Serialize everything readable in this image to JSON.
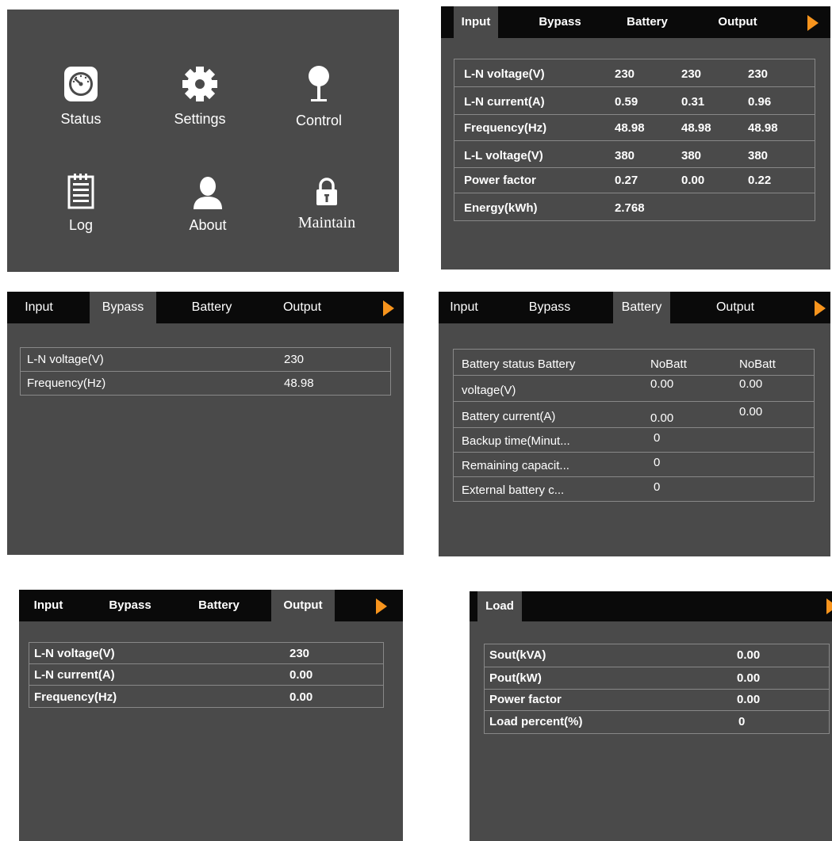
{
  "home": {
    "items": [
      {
        "label": "Status",
        "icon": "gauge-icon"
      },
      {
        "label": "Settings",
        "icon": "gear-icon"
      },
      {
        "label": "Control",
        "icon": "pin-icon"
      },
      {
        "label": "Log",
        "icon": "notepad-icon"
      },
      {
        "label": "About",
        "icon": "person-icon"
      },
      {
        "label": "Maintain",
        "icon": "lock-icon"
      }
    ]
  },
  "tabs": [
    "Input",
    "Bypass",
    "Battery",
    "Output"
  ],
  "input_panel": {
    "rows": [
      {
        "label": "L-N voltage(V)",
        "v1": "230",
        "v2": "230",
        "v3": "230"
      },
      {
        "label": "L-N current(A)",
        "v1": "0.59",
        "v2": "0.31",
        "v3": "0.96"
      },
      {
        "label": "Frequency(Hz)",
        "v1": "48.98",
        "v2": "48.98",
        "v3": "48.98"
      },
      {
        "label": "L-L voltage(V)",
        "v1": "380",
        "v2": "380",
        "v3": "380"
      },
      {
        "label": "Power factor",
        "v1": "0.27",
        "v2": "0.00",
        "v3": "0.22"
      },
      {
        "label": "Energy(kWh)",
        "v1": "2.768",
        "v2": "",
        "v3": ""
      }
    ]
  },
  "bypass_panel": {
    "rows": [
      {
        "label": "L-N  voltage(V)",
        "v1": "230"
      },
      {
        "label": "Frequency(Hz)",
        "v1": "48.98"
      }
    ]
  },
  "battery_panel": {
    "rows": [
      {
        "label": "Battery status Battery",
        "v1": "NoBatt",
        "v2": "NoBatt"
      },
      {
        "label": "voltage(V)",
        "v1": "0.00",
        "v2": "0.00"
      },
      {
        "label": "Battery current(A)",
        "v1": "0.00",
        "v2": "0.00"
      },
      {
        "label": "Backup time(Minut...",
        "v1": "0",
        "v2": ""
      },
      {
        "label": "Remaining capacit...",
        "v1": "0",
        "v2": ""
      },
      {
        "label": "External battery c...",
        "v1": "0",
        "v2": ""
      }
    ]
  },
  "output_panel": {
    "rows": [
      {
        "label": "L-N voltage(V)",
        "v1": "230"
      },
      {
        "label": "L-N current(A)",
        "v1": "0.00"
      },
      {
        "label": "Frequency(Hz)",
        "v1": "0.00"
      }
    ]
  },
  "load_panel": {
    "tab": "Load",
    "rows": [
      {
        "label": "Sout(kVA)",
        "v1": "0.00"
      },
      {
        "label": "Pout(kW)",
        "v1": "0.00"
      },
      {
        "label": "Power factor",
        "v1": "0.00"
      },
      {
        "label": "Load percent(%)",
        "v1": "0"
      }
    ]
  },
  "colors": {
    "panel_bg": "#4a4a4a",
    "tabbar_bg": "#0a0a0a",
    "accent": "#f7941d",
    "grid": "#888888"
  }
}
